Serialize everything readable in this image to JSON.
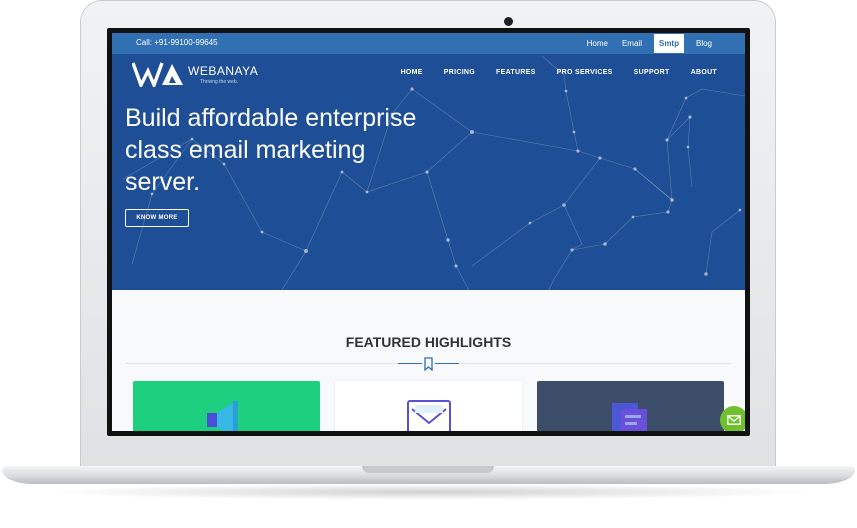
{
  "topbar": {
    "phone": "Call: +91-99100-99645",
    "links": [
      {
        "label": "Home",
        "active": false
      },
      {
        "label": "Email",
        "active": false
      },
      {
        "label": "Smtp",
        "active": true
      },
      {
        "label": "Blog",
        "active": false
      }
    ]
  },
  "header": {
    "logo": {
      "name": "WEBANAYA",
      "tagline": "Thriving the web."
    },
    "nav": [
      "HOME",
      "PRICING",
      "FEATURES",
      "PRO SERVICES",
      "SUPPORT",
      "ABOUT"
    ]
  },
  "hero": {
    "title": "Build affordable enterprise class email marketing server.",
    "cta": "KNOW MORE"
  },
  "highlights": {
    "title": "FEATURED HIGHLIGHTS",
    "cards": [
      {
        "icon": "megaphone-icon",
        "color": "#1dd07f"
      },
      {
        "icon": "envelope-icon",
        "color": "#ffffff"
      },
      {
        "icon": "document-icon",
        "color": "#3c4d6a"
      }
    ]
  },
  "colors": {
    "topbar": "#3070b3",
    "hero": "#1e4e95",
    "fab": "#6fc02c",
    "laptop": "#e4e6e9"
  },
  "icons": {
    "logo": "wa-logo-icon",
    "bookmark": "bookmark-icon",
    "fab": "mail-icon"
  }
}
